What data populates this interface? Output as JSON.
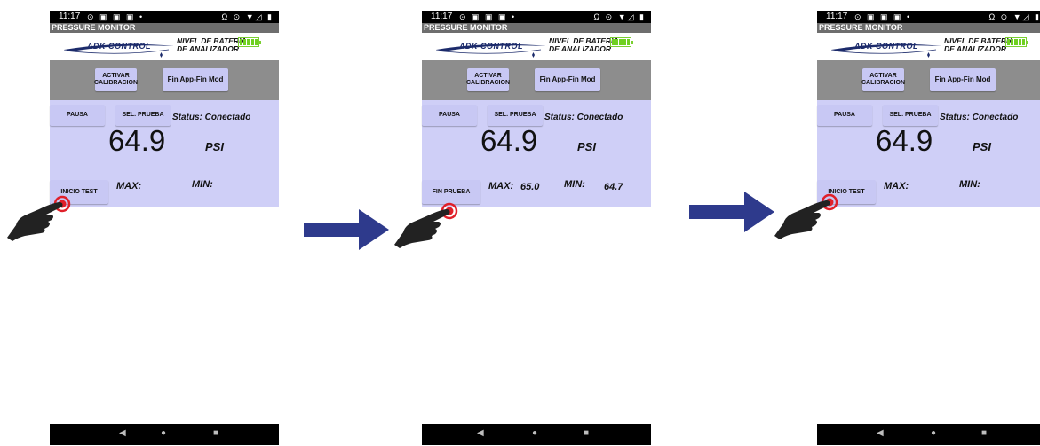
{
  "frames": [
    {
      "statusbar": {
        "time": "11:17",
        "left_icons": "⊙ ▣ ▣ ▣ •",
        "right_icons": "Ω ⊙ ▼◿ ▮"
      },
      "app_title": "PRESSURE MONITOR",
      "logo_text": "ADK CONTROL",
      "battery_label_line1": "NIVEL DE BATERIA",
      "battery_label_line2": "DE ANALIZADOR",
      "btn_calibrate": "ACTIVAR CALIBRACION",
      "btn_finapp": "Fin App-Fin Mod",
      "btn_pause": "PAUSA",
      "btn_select": "SEL. PRUEBA",
      "status": "Status: Conectado",
      "reading": "64.9",
      "unit": "PSI",
      "btn_test": "INICIO TEST",
      "max_label": "MAX:",
      "max_value": "",
      "min_label": "MIN:",
      "min_value": "",
      "nav": {
        "back": "◀",
        "home": "●",
        "recent": "■"
      }
    },
    {
      "statusbar": {
        "time": "11:17",
        "left_icons": "⊙ ▣ ▣ ▣ •",
        "right_icons": "Ω ⊙ ▼◿ ▮"
      },
      "app_title": "PRESSURE MONITOR",
      "logo_text": "ADK CONTROL",
      "battery_label_line1": "NIVEL DE BATERIA",
      "battery_label_line2": "DE ANALIZADOR",
      "btn_calibrate": "ACTIVAR CALIBRACION",
      "btn_finapp": "Fin App-Fin Mod",
      "btn_pause": "PAUSA",
      "btn_select": "SEL. PRUEBA",
      "status": "Status: Conectado",
      "reading": "64.9",
      "unit": "PSI",
      "btn_test": "FIN PRUEBA",
      "max_label": "MAX:",
      "max_value": "65.0",
      "min_label": "MIN:",
      "min_value": "64.7",
      "nav": {
        "back": "◀",
        "home": "●",
        "recent": "■"
      }
    },
    {
      "statusbar": {
        "time": "11:17",
        "left_icons": "⊙ ▣ ▣ ▣ •",
        "right_icons": "Ω ⊙ ▼◿ ▮"
      },
      "app_title": "PRESSURE MONITOR",
      "logo_text": "ADK CONTROL",
      "battery_label_line1": "NIVEL DE BATERIA",
      "battery_label_line2": "DE ANALIZADOR",
      "btn_calibrate": "ACTIVAR CALIBRACION",
      "btn_finapp": "Fin App-Fin Mod",
      "btn_pause": "PAUSA",
      "btn_select": "SEL. PRUEBA",
      "status": "Status: Conectado",
      "reading": "64.9",
      "unit": "PSI",
      "btn_test": "INICIO TEST",
      "max_label": "MAX:",
      "max_value": "",
      "min_label": "MIN:",
      "min_value": "",
      "nav": {
        "back": "◀",
        "home": "●",
        "recent": "■"
      }
    }
  ],
  "colors": {
    "arrow": "#2e3a8c",
    "panel": "#cfcff7",
    "button": "#c8c8f4",
    "battery": "#6fd020",
    "touch": "#e0202a"
  },
  "icons": [
    "tap-hand-icon",
    "right-arrow-icon",
    "battery-icon",
    "back-nav-icon",
    "home-nav-icon",
    "recents-nav-icon"
  ]
}
